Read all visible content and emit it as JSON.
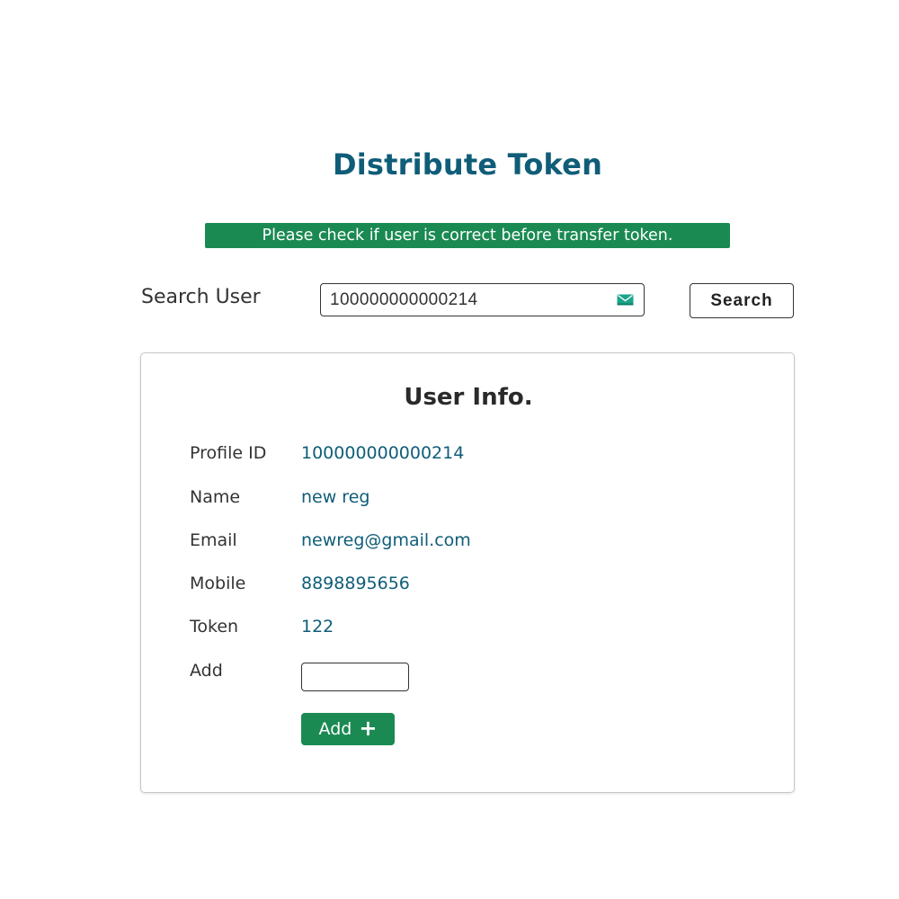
{
  "page": {
    "title": "Distribute Token",
    "notice": "Please check if user is correct before transfer token."
  },
  "search": {
    "label": "Search User",
    "value": "100000000000214",
    "button_label": "Search",
    "field_icon": "mail-icon",
    "icon_color": "#1aa58a"
  },
  "user_info": {
    "title": "User Info.",
    "rows": [
      {
        "label": "Profile ID",
        "value": "100000000000214"
      },
      {
        "label": "Name",
        "value": "new reg"
      },
      {
        "label": "Email",
        "value": "newreg@gmail.com"
      },
      {
        "label": "Mobile",
        "value": "8898895656"
      },
      {
        "label": "Token",
        "value": "122"
      }
    ],
    "add_label": "Add",
    "add_input_value": "",
    "add_button_label": "Add",
    "add_button_icon": "plus-icon"
  },
  "colors": {
    "primary_text": "#0f5d78",
    "accent_green": "#1a8a52"
  }
}
